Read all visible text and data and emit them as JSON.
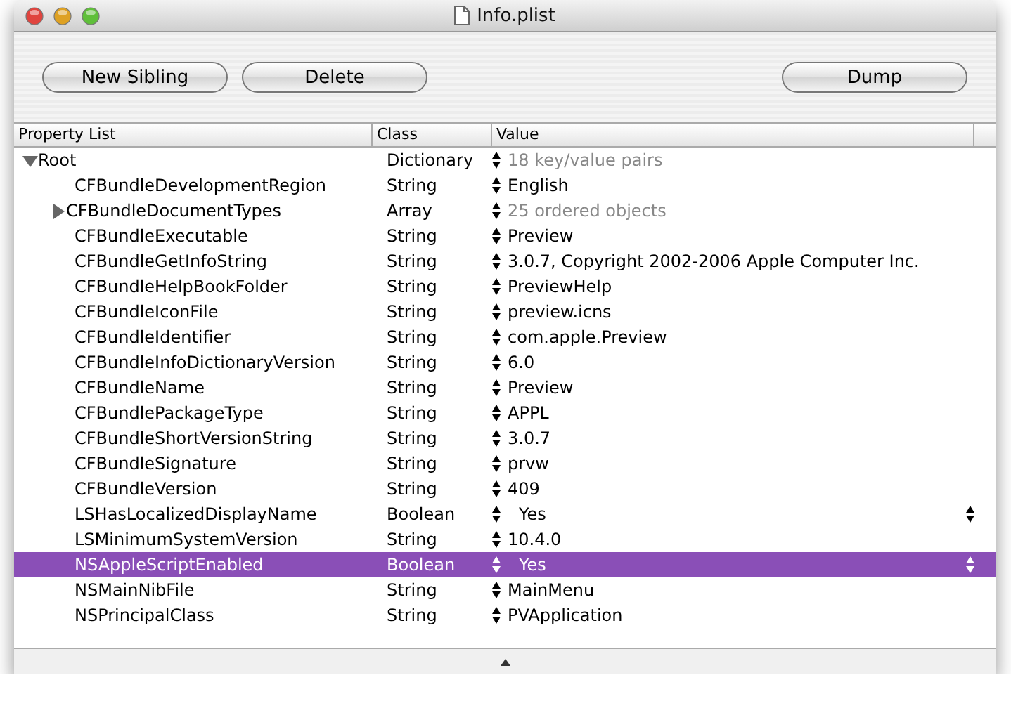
{
  "window": {
    "title": "Info.plist"
  },
  "toolbar": {
    "buttons": [
      "New Sibling",
      "Delete",
      "Dump"
    ]
  },
  "table": {
    "columns": [
      "Property List",
      "Class",
      "Value"
    ],
    "rows": [
      {
        "key": "Root",
        "class": "Dictionary",
        "value": "18 key/value pairs",
        "kind": "container",
        "expanded": true,
        "selected": false,
        "children": [
          {
            "key": "CFBundleDevelopmentRegion",
            "class": "String",
            "value": "English",
            "kind": "string",
            "selected": false
          },
          {
            "key": "CFBundleDocumentTypes",
            "class": "Array",
            "value": "25 ordered objects",
            "kind": "container",
            "expanded": false,
            "selected": false
          },
          {
            "key": "CFBundleExecutable",
            "class": "String",
            "value": "Preview",
            "kind": "string",
            "selected": false
          },
          {
            "key": "CFBundleGetInfoString",
            "class": "String",
            "value": "3.0.7, Copyright 2002-2006 Apple Computer Inc.",
            "kind": "string",
            "selected": false
          },
          {
            "key": "CFBundleHelpBookFolder",
            "class": "String",
            "value": "PreviewHelp",
            "kind": "string",
            "selected": false
          },
          {
            "key": "CFBundleIconFile",
            "class": "String",
            "value": "preview.icns",
            "kind": "string",
            "selected": false
          },
          {
            "key": "CFBundleIdentifier",
            "class": "String",
            "value": "com.apple.Preview",
            "kind": "string",
            "selected": false
          },
          {
            "key": "CFBundleInfoDictionaryVersion",
            "class": "String",
            "value": "6.0",
            "kind": "string",
            "selected": false
          },
          {
            "key": "CFBundleName",
            "class": "String",
            "value": "Preview",
            "kind": "string",
            "selected": false
          },
          {
            "key": "CFBundlePackageType",
            "class": "String",
            "value": "APPL",
            "kind": "string",
            "selected": false
          },
          {
            "key": "CFBundleShortVersionString",
            "class": "String",
            "value": "3.0.7",
            "kind": "string",
            "selected": false
          },
          {
            "key": "CFBundleSignature",
            "class": "String",
            "value": "prvw",
            "kind": "string",
            "selected": false
          },
          {
            "key": "CFBundleVersion",
            "class": "String",
            "value": "409",
            "kind": "string",
            "selected": false
          },
          {
            "key": "LSHasLocalizedDisplayName",
            "class": "Boolean",
            "value": "Yes",
            "kind": "boolean",
            "selected": false
          },
          {
            "key": "LSMinimumSystemVersion",
            "class": "String",
            "value": "10.4.0",
            "kind": "string",
            "selected": false
          },
          {
            "key": "NSAppleScriptEnabled",
            "class": "Boolean",
            "value": "Yes",
            "kind": "boolean",
            "selected": true
          },
          {
            "key": "NSMainNibFile",
            "class": "String",
            "value": "MainMenu",
            "kind": "string",
            "selected": false
          },
          {
            "key": "NSPrincipalClass",
            "class": "String",
            "value": "PVApplication",
            "kind": "string",
            "selected": false
          }
        ]
      }
    ]
  }
}
